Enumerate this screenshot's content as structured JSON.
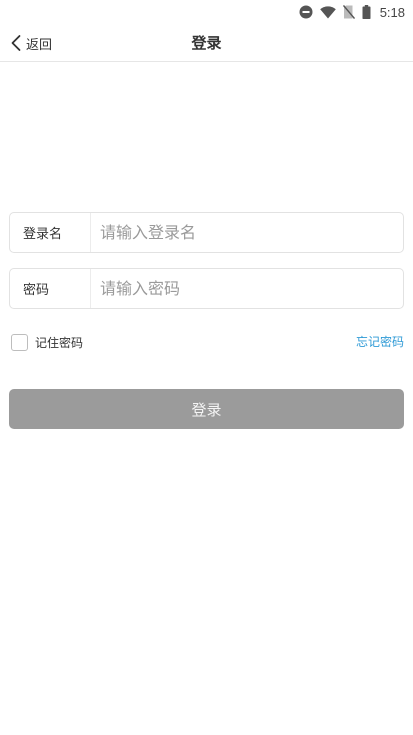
{
  "status_bar": {
    "time": "5:18",
    "icons": [
      "do-not-disturb-icon",
      "wifi-icon",
      "no-sim-icon",
      "battery-icon"
    ]
  },
  "nav": {
    "back_label": "返回",
    "title": "登录"
  },
  "form": {
    "username": {
      "label": "登录名",
      "placeholder": "请输入登录名",
      "value": ""
    },
    "password": {
      "label": "密码",
      "placeholder": "请输入密码",
      "value": ""
    },
    "remember_label": "记住密码",
    "remember_checked": false,
    "forgot_label": "忘记密码",
    "submit_label": "登录"
  },
  "colors": {
    "accent_link": "#2e9ad6",
    "button_disabled": "#9b9b9b",
    "border": "#e2e2e2"
  }
}
